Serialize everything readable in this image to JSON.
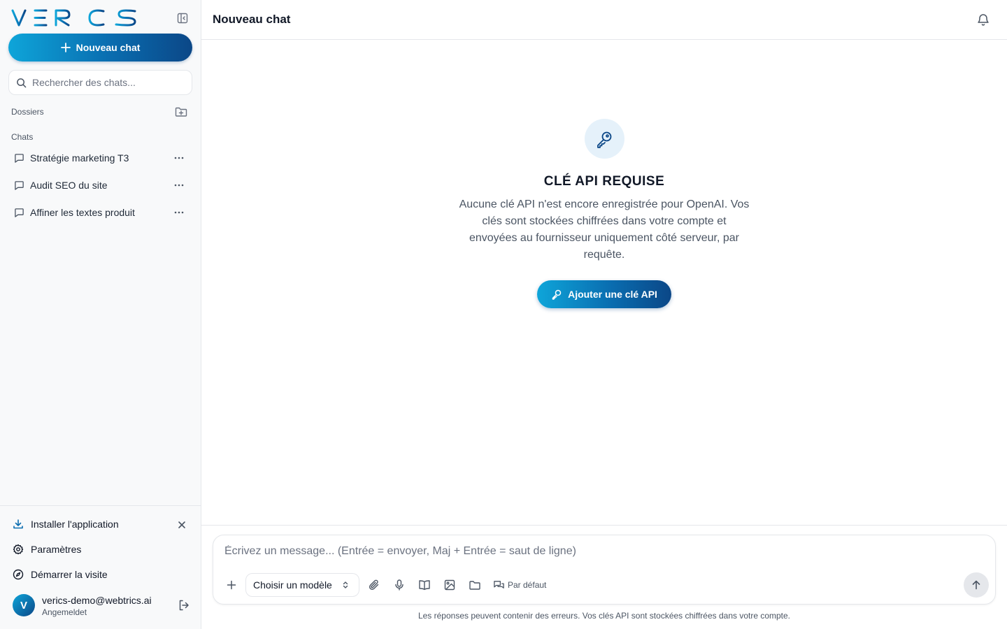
{
  "brand": {
    "logo_text": "VERICS"
  },
  "sidebar": {
    "new_chat_label": "Nouveau chat",
    "search_placeholder": "Rechercher des chats...",
    "folders_label": "Dossiers",
    "chats_label": "Chats",
    "chats": [
      {
        "title": "Stratégie marketing T3"
      },
      {
        "title": "Audit SEO du site"
      },
      {
        "title": "Affiner les textes produit"
      }
    ],
    "footer": {
      "install_label": "Installer l'application",
      "settings_label": "Paramètres",
      "tour_label": "Démarrer la visite"
    },
    "user": {
      "initial": "V",
      "email": "verics-demo@webtrics.ai",
      "status": "Angemeldet"
    }
  },
  "header": {
    "title": "Nouveau chat"
  },
  "empty_state": {
    "title": "CLÉ API REQUISE",
    "description": "Aucune clé API n'est encore enregistrée pour OpenAI. Vos clés sont stockées chiffrées dans votre compte et envoyées au fournisseur uniquement côté serveur, par requête.",
    "button_label": "Ajouter une clé API"
  },
  "composer": {
    "placeholder": "Écrivez un message... (Entrée = envoyer, Maj + Entrée = saut de ligne)",
    "model_label": "Choisir un modèle",
    "mode_label": "Par défaut",
    "disclaimer": "Les réponses peuvent contenir des erreurs. Vos clés API sont stockées chiffrées dans votre compte."
  },
  "colors": {
    "accent_start": "#0ea5d9",
    "accent_end": "#0b4787",
    "sidebar_bg": "#f8f9fa"
  },
  "icons": [
    "collapse-sidebar-icon",
    "plus-icon",
    "search-icon",
    "folder-plus-icon",
    "message-icon",
    "more-icon",
    "download-icon",
    "close-icon",
    "gear-icon",
    "compass-icon",
    "logout-icon",
    "bell-icon",
    "key-icon",
    "paperclip-icon",
    "microphone-icon",
    "book-icon",
    "image-icon",
    "folder-icon",
    "messages-icon",
    "chevron-updown-icon",
    "arrow-up-icon"
  ]
}
